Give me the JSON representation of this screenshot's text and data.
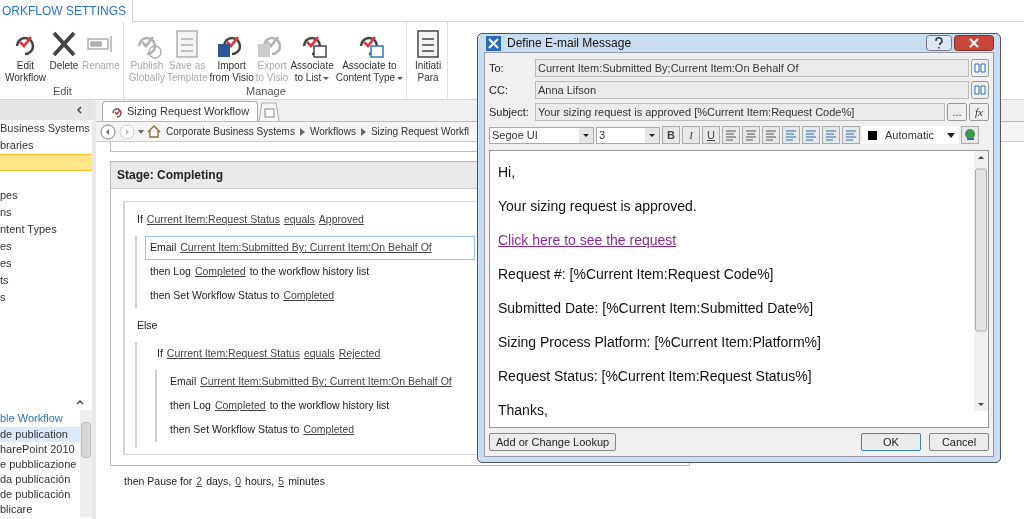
{
  "ribbon": {
    "tab": "ORKFLOW SETTINGS",
    "groups": [
      {
        "label": "Edit",
        "buttons": [
          {
            "lines": [
              "Edit",
              "Workflow"
            ],
            "disabled": false,
            "dropdown": false
          },
          {
            "lines": [
              "Delete"
            ],
            "disabled": false,
            "dropdown": false
          },
          {
            "lines": [
              "Rename"
            ],
            "disabled": true,
            "dropdown": false
          }
        ]
      },
      {
        "label": "Manage",
        "buttons": [
          {
            "lines": [
              "Publish",
              "Globally"
            ],
            "disabled": true,
            "dropdown": false
          },
          {
            "lines": [
              "Save as",
              "Template"
            ],
            "disabled": true,
            "dropdown": false
          },
          {
            "lines": [
              "Import",
              "from Visio"
            ],
            "disabled": false,
            "dropdown": false
          },
          {
            "lines": [
              "Export",
              "to Visio"
            ],
            "disabled": true,
            "dropdown": false
          },
          {
            "lines": [
              "Associate",
              "to List"
            ],
            "disabled": false,
            "dropdown": true
          },
          {
            "lines": [
              "Associate to",
              "Content Type"
            ],
            "disabled": false,
            "dropdown": true
          }
        ]
      },
      {
        "buttons": [
          {
            "lines": [
              "Initiati",
              "Para"
            ],
            "disabled": false,
            "dropdown": false
          }
        ]
      }
    ]
  },
  "navigation": {
    "sections": [
      {
        "items": [
          {
            "kind": "item",
            "label": "Business Systems",
            "selected": false
          },
          {
            "kind": "item",
            "label": "braries",
            "selected": false
          },
          {
            "kind": "item",
            "selected": true
          },
          {
            "kind": "spacer"
          },
          {
            "kind": "item",
            "label": "pes",
            "selected": false
          },
          {
            "kind": "item",
            "label": "ns",
            "selected": false
          },
          {
            "kind": "item",
            "label": "ntent Types",
            "selected": false
          },
          {
            "kind": "item",
            "label": "es",
            "selected": false
          },
          {
            "kind": "item",
            "label": "es",
            "selected": false
          },
          {
            "kind": "item",
            "label": "ts",
            "selected": false
          },
          {
            "kind": "item",
            "label": "s",
            "selected": false
          }
        ]
      },
      {
        "items": [
          {
            "kind": "header",
            "label": "ble Workflow"
          },
          {
            "kind": "item",
            "label": "de publication",
            "selected": true
          },
          {
            "kind": "item",
            "label": "harePoint 2010",
            "selected": false
          },
          {
            "kind": "item",
            "label": "e pubblicazione",
            "selected": false
          },
          {
            "kind": "item",
            "label": "da publicación",
            "selected": false
          },
          {
            "kind": "item",
            "label": "de publicación",
            "selected": false
          },
          {
            "kind": "item",
            "label": "blicare",
            "selected": false
          }
        ]
      }
    ]
  },
  "editor": {
    "tab": {
      "label": "Sizing Request Workflow",
      "selected": true
    },
    "breadcrumb": [
      "Corporate Business Systems",
      "Workflows",
      "Sizing Request Workfl"
    ],
    "stage": {
      "title": "Stage: Completing",
      "blocks": [
        {
          "kind": "branch",
          "parts": [
            {
              "t": "If",
              "link": false
            },
            {
              "t": "Current Item:Request Status",
              "link": true
            },
            {
              "t": "equals",
              "link": true
            },
            {
              "t": "Approved",
              "link": true
            }
          ],
          "children": [
            {
              "kind": "action",
              "selected": true,
              "parts": [
                {
                  "t": "Email",
                  "link": false
                },
                {
                  "t": "Current Item:Submitted By; Current Item:On Behalf Of",
                  "link": true
                }
              ]
            },
            {
              "kind": "action",
              "selected": false,
              "parts": [
                {
                  "t": "then Log",
                  "link": false
                },
                {
                  "t": "Completed",
                  "link": true
                },
                {
                  "t": "to the workflow history list",
                  "link": false
                }
              ]
            },
            {
              "kind": "action",
              "selected": false,
              "parts": [
                {
                  "t": "then Set Workflow Status to",
                  "link": false
                },
                {
                  "t": "Completed",
                  "link": true
                }
              ]
            }
          ]
        },
        {
          "kind": "branch",
          "parts": [
            {
              "t": "Else",
              "link": false
            }
          ],
          "children": [
            {
              "kind": "branch",
              "parts": [
                {
                  "t": "If",
                  "link": false
                },
                {
                  "t": "Current Item:Request Status",
                  "link": true
                },
                {
                  "t": "equals",
                  "link": true
                },
                {
                  "t": "Rejected",
                  "link": true
                }
              ],
              "children": [
                {
                  "kind": "action",
                  "selected": false,
                  "parts": [
                    {
                      "t": "Email",
                      "link": false
                    },
                    {
                      "t": "Current Item:Submitted By; Current Item:On Behalf Of",
                      "link": true
                    }
                  ]
                },
                {
                  "kind": "action",
                  "selected": false,
                  "parts": [
                    {
                      "t": "then Log",
                      "link": false
                    },
                    {
                      "t": "Completed",
                      "link": true
                    },
                    {
                      "t": "to the workflow history list",
                      "link": false
                    }
                  ]
                },
                {
                  "kind": "action",
                  "selected": false,
                  "parts": [
                    {
                      "t": "then Set Workflow Status to",
                      "link": false
                    },
                    {
                      "t": "Completed",
                      "link": true
                    }
                  ]
                }
              ]
            }
          ]
        }
      ],
      "after": [
        {
          "t": "then Pause for",
          "link": false
        },
        {
          "t": "2",
          "link": true
        },
        {
          "t": "days,",
          "link": false
        },
        {
          "t": "0",
          "link": true
        },
        {
          "t": "hours,",
          "link": false
        },
        {
          "t": "5",
          "link": true
        },
        {
          "t": "minutes",
          "link": false
        }
      ]
    }
  },
  "dialog": {
    "title": "Define E-mail Message",
    "fields": [
      {
        "label": "To:",
        "value": "Current Item:Submitted By;Current Item:On Behalf Of",
        "kind": "people"
      },
      {
        "label": "CC:",
        "value": "Anna Lifson",
        "kind": "people"
      },
      {
        "label": "Subject:",
        "value": "Your sizing request is approved [%Current Item:Request Code%]",
        "kind": "formula",
        "buttons": [
          "...",
          "fx"
        ]
      }
    ],
    "toolbar": {
      "font": "Segoe UI",
      "size": "3",
      "format": [
        "B",
        "I",
        "U"
      ],
      "color_name": "Automatic",
      "color": "#000000"
    },
    "body": [
      {
        "kind": "text",
        "t": "Hi,"
      },
      {
        "kind": "text",
        "t": "Your sizing request is approved."
      },
      {
        "kind": "link",
        "t": "Click here to see the request"
      },
      {
        "kind": "text",
        "t": "Request #: [%Current Item:Request Code%]"
      },
      {
        "kind": "text",
        "t": "Submitted Date: [%Current Item:Submitted Date%]"
      },
      {
        "kind": "text",
        "t": "Sizing Process Platform: [%Current Item:Platform%]"
      },
      {
        "kind": "text",
        "t": "Request Status: [%Current Item:Request Status%]"
      },
      {
        "kind": "text",
        "t": "Thanks,"
      }
    ],
    "lookup_button": "Add or Change Lookup",
    "buttons": [
      {
        "label": "OK",
        "default": true
      },
      {
        "label": "Cancel",
        "default": false
      }
    ]
  }
}
